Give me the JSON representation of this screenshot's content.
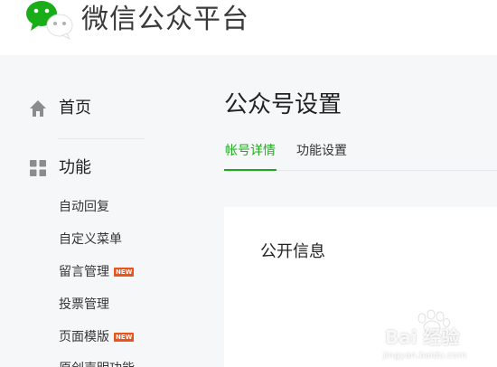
{
  "header": {
    "brand": "微信公众平台",
    "logo_icon": "wechat-logo-icon",
    "brand_color": "#1aad19"
  },
  "sidebar": {
    "home": {
      "label": "首页",
      "icon": "home-icon"
    },
    "function": {
      "label": "功能",
      "icon": "grid-icon"
    },
    "items": [
      {
        "label": "自动回复",
        "badge": ""
      },
      {
        "label": "自定义菜单",
        "badge": ""
      },
      {
        "label": "留言管理",
        "badge": "NEW"
      },
      {
        "label": "投票管理",
        "badge": ""
      },
      {
        "label": "页面模版",
        "badge": "NEW"
      },
      {
        "label": "原创声明功能",
        "badge": ""
      }
    ]
  },
  "main": {
    "title": "公众号设置",
    "tabs": [
      {
        "label": "帐号详情",
        "active": true
      },
      {
        "label": "功能设置",
        "active": false
      }
    ],
    "section_title": "公开信息"
  },
  "watermark": {
    "text": "Bai 经验",
    "sub": "jingyan.baidu.com"
  },
  "colors": {
    "accent": "#1aad19",
    "badge": "#e8541e",
    "background": "#f6f7f9"
  }
}
